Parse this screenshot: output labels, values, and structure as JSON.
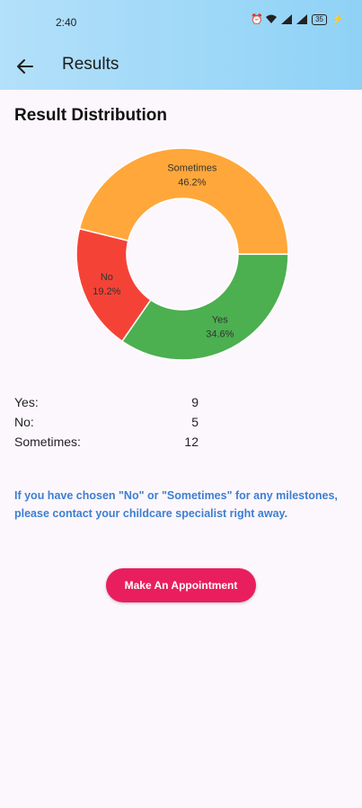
{
  "status_bar": {
    "time": "2:40",
    "icons": [
      "alarm-icon",
      "wifi-icon",
      "signal-icon",
      "signal-icon",
      "battery-icon",
      "charging-icon"
    ],
    "battery_level": "35"
  },
  "app_bar": {
    "title": "Results",
    "back_icon": "arrow-left-icon",
    "background_colors": [
      "#b3e0fa",
      "#8fd2f6"
    ]
  },
  "section": {
    "title": "Result Distribution"
  },
  "chart_data": {
    "type": "pie",
    "donut": true,
    "slices": [
      {
        "label": "Yes",
        "percent_label": "34.6%",
        "value": 9,
        "color": "#4caf50"
      },
      {
        "label": "No",
        "percent_label": "19.2%",
        "value": 5,
        "color": "#f44336"
      },
      {
        "label": "Sometimes",
        "percent_label": "46.2%",
        "value": 12,
        "color": "#ffa73a"
      }
    ]
  },
  "counts": [
    {
      "label": "Yes:",
      "value": "9"
    },
    {
      "label": "No:",
      "value": "5"
    },
    {
      "label": "Sometimes:",
      "value": "12"
    }
  ],
  "advice": {
    "text": "If you have chosen \"No\" or \"Sometimes\" for any milestones, please contact your childcare specialist right away.",
    "color": "#3c7fd1"
  },
  "cta": {
    "label": "Make An Appointment",
    "color": "#e91e5f"
  }
}
